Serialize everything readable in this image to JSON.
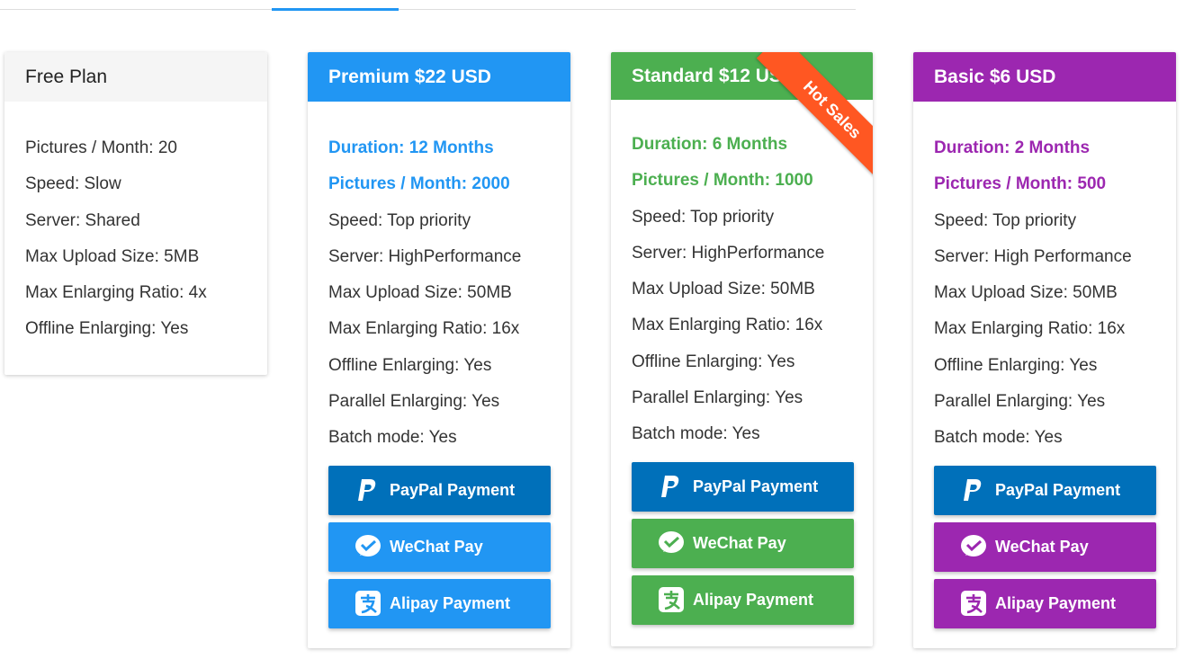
{
  "plans": {
    "free": {
      "title": "Free Plan",
      "features": [
        "Pictures / Month: 20",
        "Speed: Slow",
        "Server: Shared",
        "Max Upload Size: 5MB",
        "Max Enlarging Ratio: 4x",
        "Offline Enlarging: Yes"
      ]
    },
    "premium": {
      "title": "Premium $22 USD",
      "duration": "Duration: 12 Months",
      "pictures": "Pictures / Month: 2000",
      "features": [
        "Speed: Top priority",
        "Server: HighPerformance",
        "Max Upload Size: 50MB",
        "Max Enlarging Ratio: 16x",
        "Offline Enlarging: Yes",
        "Parallel Enlarging: Yes",
        "Batch mode: Yes"
      ],
      "accent_color": "#2196f3"
    },
    "standard": {
      "title": "Standard $12 USD",
      "ribbon": "Hot Sales",
      "duration": "Duration: 6 Months",
      "pictures": "Pictures / Month: 1000",
      "features": [
        "Speed: Top priority",
        "Server: HighPerformance",
        "Max Upload Size: 50MB",
        "Max Enlarging Ratio: 16x",
        "Offline Enlarging: Yes",
        "Parallel Enlarging: Yes",
        "Batch mode: Yes"
      ],
      "accent_color": "#4caf50",
      "ribbon_color": "#ff5722"
    },
    "basic": {
      "title": "Basic $6 USD",
      "duration": "Duration: 2 Months",
      "pictures": "Pictures / Month: 500",
      "features": [
        "Speed: Top priority",
        "Server: High Performance",
        "Max Upload Size: 50MB",
        "Max Enlarging Ratio: 16x",
        "Offline Enlarging: Yes",
        "Parallel Enlarging: Yes",
        "Batch mode: Yes"
      ],
      "accent_color": "#9c27b0"
    }
  },
  "buttons": {
    "paypal": "PayPal Payment",
    "wechat": "WeChat Pay",
    "alipay": "Alipay Payment",
    "paypal_color": "#0070ba"
  },
  "icons": {
    "paypal": "paypal-icon",
    "wechat": "wechat-icon",
    "alipay": "alipay-icon"
  }
}
